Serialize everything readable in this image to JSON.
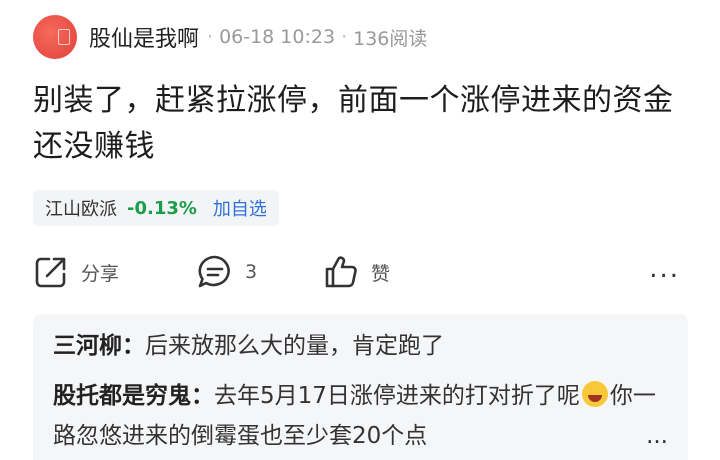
{
  "author": {
    "name": "股仙是我啊",
    "date": "06-18 10:23",
    "reads": "136阅读"
  },
  "post": {
    "text": "别装了，赶紧拉涨停，前面一个涨停进来的资金还没赚钱"
  },
  "stock": {
    "name": "江山欧派",
    "change": "-0.13%",
    "add_label": "加自选",
    "change_color": "#1a9e4b"
  },
  "actions": {
    "share_label": "分享",
    "comment_count": "3",
    "like_label": "赞",
    "more_label": "..."
  },
  "comments": [
    {
      "user": "三河柳：",
      "text": "后来放那么大的量，肯定跑了"
    },
    {
      "user": "股托都是穷鬼：",
      "text_a": "去年5月17日涨停进来的打对折了呢",
      "text_b": "你一路忽悠进来的倒霉蛋也至少套20个点",
      "ellipsis": "..."
    }
  ]
}
